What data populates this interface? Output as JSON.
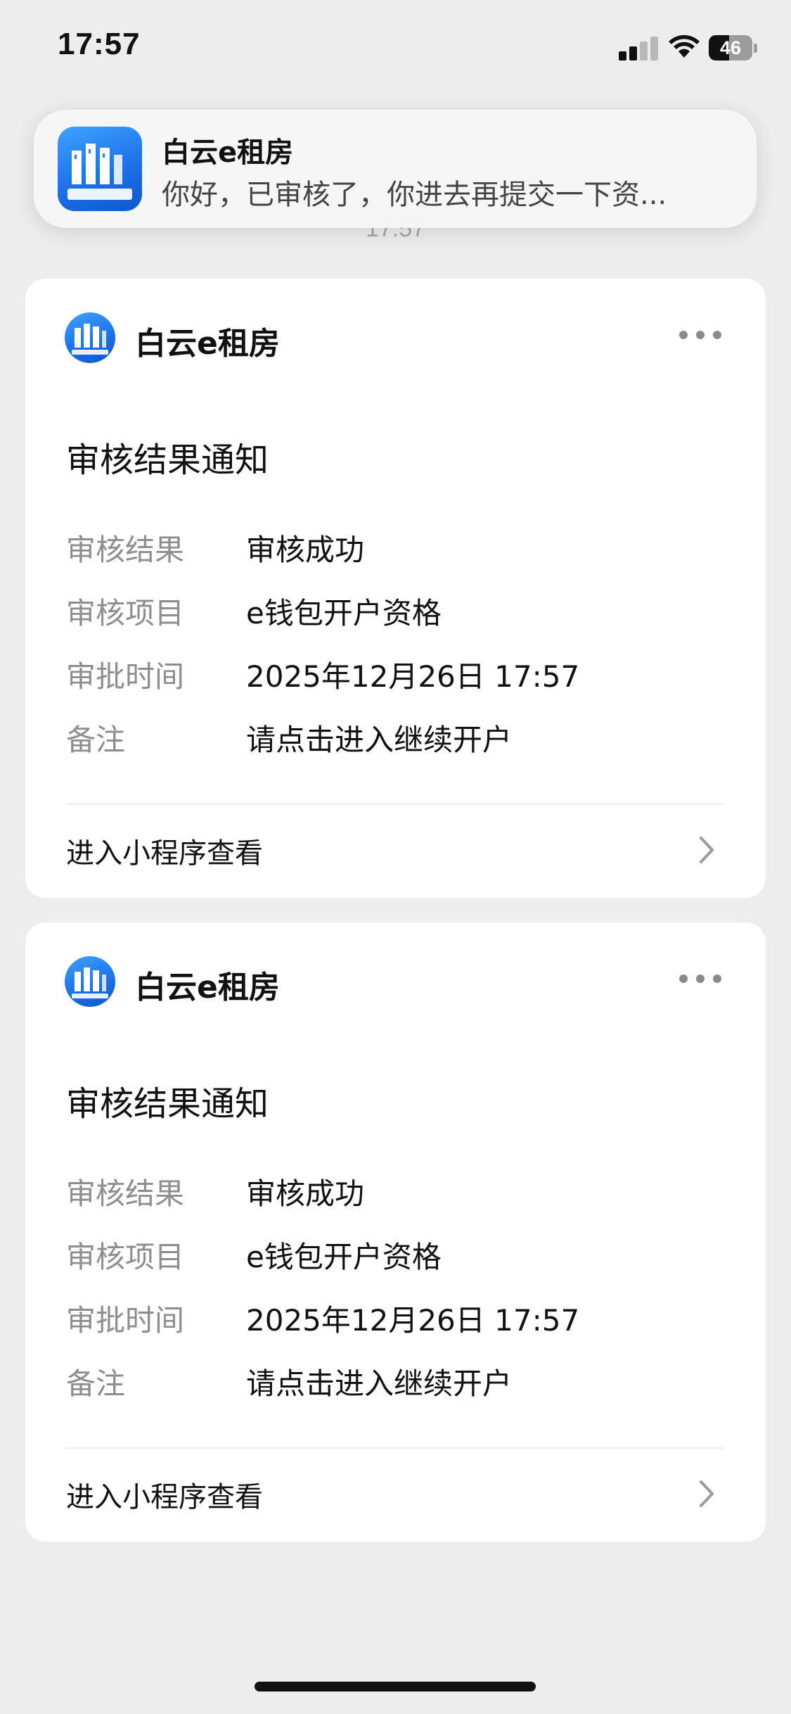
{
  "status_bar": {
    "time": "17:57",
    "battery": "46",
    "battery_level": 0.46
  },
  "chat": {
    "timestamp": "17:57"
  },
  "notification": {
    "app_name": "白云e租房",
    "body": "你好，已审核了，你进去再提交一下资..."
  },
  "cards": [
    {
      "source": "白云e租房",
      "title": "审核结果通知",
      "fields": [
        {
          "label": "审核结果",
          "value": "审核成功"
        },
        {
          "label": "审核项目",
          "value": "e钱包开户资格"
        },
        {
          "label": "审批时间",
          "value": "2025年12月26日 17:57"
        },
        {
          "label": "备注",
          "value": "请点击进入继续开户"
        }
      ],
      "link_label": "进入小程序查看"
    },
    {
      "source": "白云e租房",
      "title": "审核结果通知",
      "fields": [
        {
          "label": "审核结果",
          "value": "审核成功"
        },
        {
          "label": "审核项目",
          "value": "e钱包开户资格"
        },
        {
          "label": "审批时间",
          "value": "2025年12月26日 17:57"
        },
        {
          "label": "备注",
          "value": "请点击进入继续开户"
        }
      ],
      "link_label": "进入小程序查看"
    }
  ],
  "colors": {
    "background": "#ededed",
    "card": "#ffffff",
    "label_gray": "#8e8e8e",
    "brand_blue": "#1a6fe8"
  }
}
